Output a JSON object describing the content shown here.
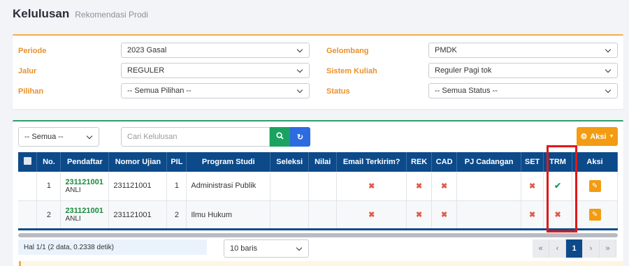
{
  "page": {
    "title": "Kelulusan",
    "subtitle": "Rekomendasi Prodi"
  },
  "filters": {
    "periode": {
      "label": "Periode",
      "value": "2023 Gasal"
    },
    "jalur": {
      "label": "Jalur",
      "value": "REGULER"
    },
    "pilihan": {
      "label": "Pilihan",
      "value": "-- Semua Pilihan --"
    },
    "gelombang": {
      "label": "Gelombang",
      "value": "PMDK"
    },
    "sistem_kuliah": {
      "label": "Sistem Kuliah",
      "value": "Reguler Pagi tok"
    },
    "status": {
      "label": "Status",
      "value": "-- Semua Status --"
    }
  },
  "toolbar": {
    "scope_select": "-- Semua --",
    "search_placeholder": "Cari Kelulusan",
    "aksi_label": "Aksi"
  },
  "table": {
    "headers": [
      "No.",
      "Pendaftar",
      "Nomor Ujian",
      "PIL",
      "Program Studi",
      "Seleksi",
      "Nilai",
      "Email Terkirim?",
      "REK",
      "CAD",
      "PJ Cadangan",
      "SET",
      "TRM",
      "Aksi"
    ],
    "rows": [
      {
        "no": "1",
        "pendaftar_id": "231121001",
        "pendaftar_code": "ANLI",
        "nomor_ujian": "231121001",
        "pil": "1",
        "prodi": "Administrasi Publik",
        "email": "x",
        "rek": "x",
        "cad": "x",
        "set": "x",
        "trm": "check"
      },
      {
        "no": "2",
        "pendaftar_id": "231121001",
        "pendaftar_code": "ANLI",
        "nomor_ujian": "231121001",
        "pil": "2",
        "prodi": "Ilmu Hukum",
        "email": "x",
        "rek": "x",
        "cad": "x",
        "set": "x",
        "trm": "x"
      }
    ]
  },
  "footer": {
    "info": "Hal 1/1 (2 data, 0.2338 detik)",
    "rows_per_page": "10 baris",
    "pages": [
      "«",
      "‹",
      "1",
      "›",
      "»"
    ],
    "current_page": "1"
  },
  "icons": {
    "x": "✖",
    "check": "✔",
    "edit": "✎",
    "search": "🔍",
    "refresh": "↻",
    "gear": "⚙"
  },
  "colors": {
    "accent_orange": "#f39c12",
    "header_blue": "#0c4a8a",
    "success_green": "#1aa260",
    "danger_red": "#e05a4a",
    "highlight_red": "#e01818"
  }
}
